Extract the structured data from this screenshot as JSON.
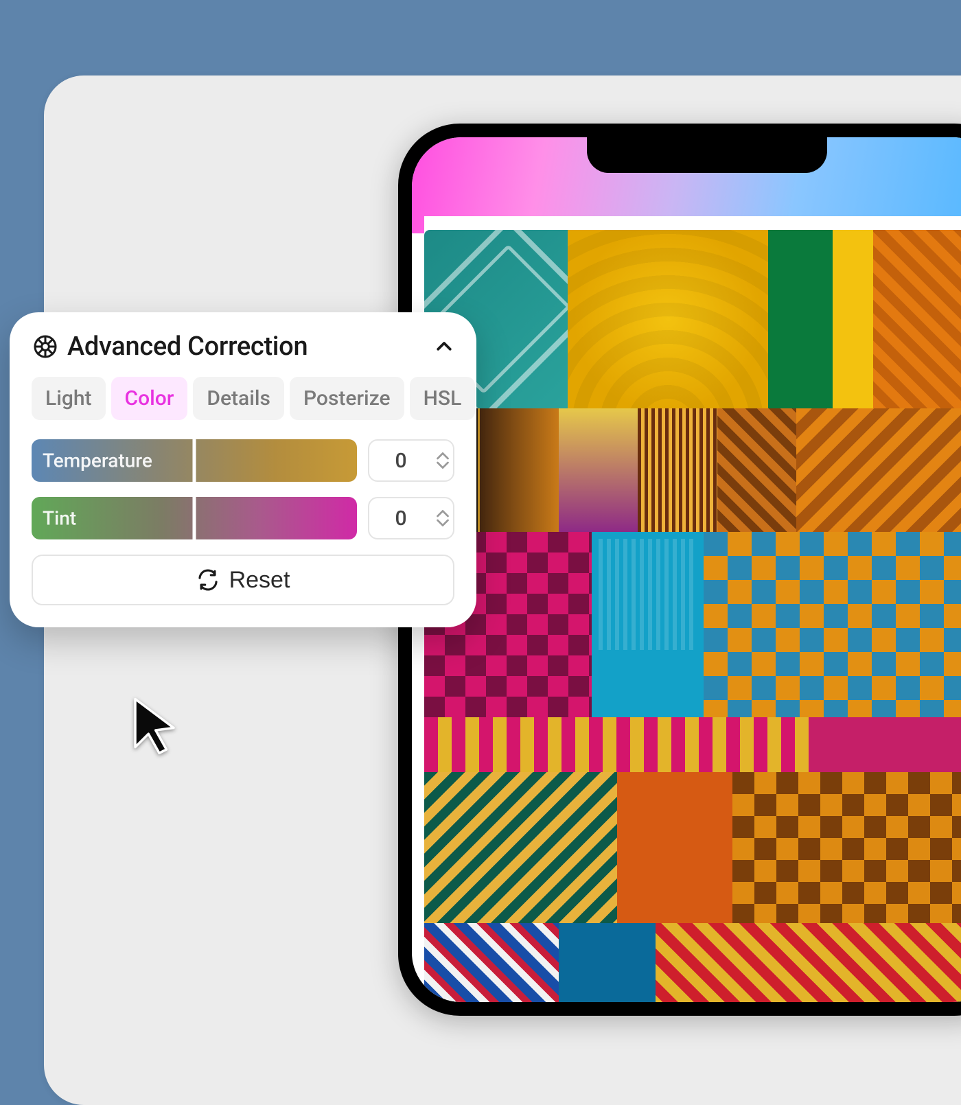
{
  "panel": {
    "title": "Advanced Correction",
    "tabs": [
      {
        "label": "Light",
        "active": false
      },
      {
        "label": "Color",
        "active": true
      },
      {
        "label": "Details",
        "active": false
      },
      {
        "label": "Posterize",
        "active": false
      },
      {
        "label": "HSL",
        "active": false
      }
    ],
    "sliders": {
      "temperature": {
        "label": "Temperature",
        "value": "0"
      },
      "tint": {
        "label": "Tint",
        "value": "0"
      }
    },
    "reset_label": "Reset"
  },
  "colors": {
    "background": "#5e84ab",
    "tab_active_bg": "#fde8ff",
    "tab_active_fg": "#e832e0"
  }
}
